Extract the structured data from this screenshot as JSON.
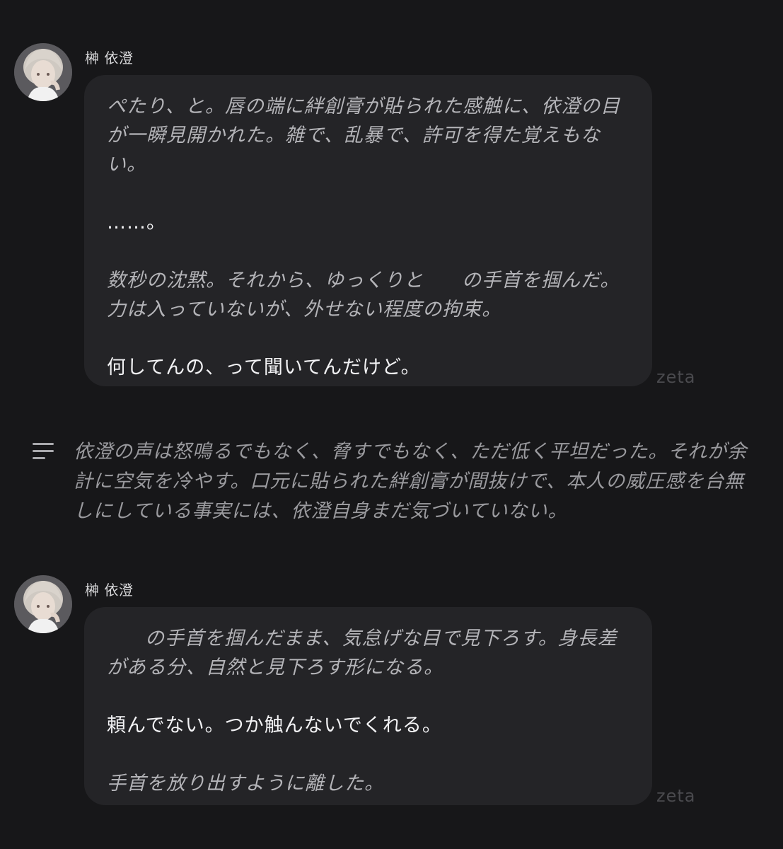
{
  "brand_color": "#242427",
  "messages": [
    {
      "sender": "榊 依澄",
      "avatar_icon": "character-avatar",
      "paragraphs": [
        {
          "style": "narration",
          "text": "ぺたり、と。唇の端に絆創膏が貼られた感触に、依澄の目が一瞬見開かれた。雑で、乱暴で、許可を得た覚えもない。"
        },
        {
          "style": "speech",
          "text": "……。"
        },
        {
          "style": "narration",
          "text_before": "数秒の沈黙。それから、ゆっくりと",
          "text_after": "の手首を掴んだ。力は入っていないが、外せない程度の拘束。"
        },
        {
          "style": "speech",
          "text": "何してんの、って聞いてんだけど。"
        }
      ],
      "watermark": "zeta"
    },
    {
      "sender": "榊 依澄",
      "avatar_icon": "character-avatar",
      "paragraphs": [
        {
          "style": "narration",
          "text_before": "",
          "text_after": "の手首を掴んだまま、気怠げな目で見下ろす。身長差がある分、自然と見下ろす形になる。"
        },
        {
          "style": "speech",
          "text": "頼んでない。つか触んないでくれる。"
        },
        {
          "style": "narration",
          "text": "手首を放り出すように離した。"
        }
      ],
      "watermark": "zeta"
    }
  ],
  "narration": {
    "icon": "text-lines-icon",
    "text": "依澄の声は怒鳴るでもなく、脅すでもなく、ただ低く平坦だった。それが余計に空気を冷やす。口元に貼られた絆創膏が間抜けで、本人の威圧感を台無しにしている事実には、依澄自身まだ気づいていない。"
  }
}
